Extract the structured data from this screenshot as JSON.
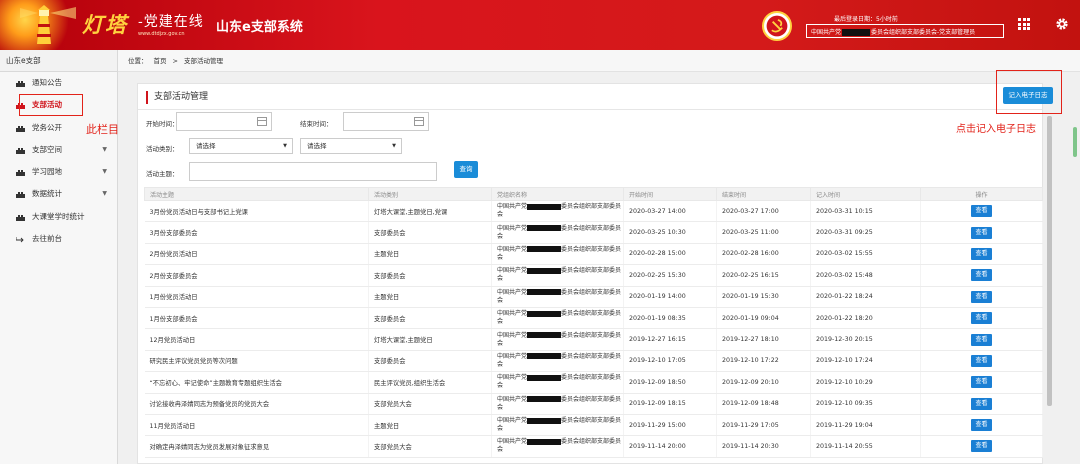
{
  "header": {
    "logo_main": "灯塔",
    "logo_sub": "-党建在线",
    "logo_url": "www.dtdjzx.gov.cn",
    "system_title": "山东e支部系统",
    "login_info": "最后登录日期：5小时前",
    "user_prefix": "中国共产党",
    "user_suffix": "委员会组织部支部委员会-党支部管理员"
  },
  "sidebar": {
    "title": "山东e支部",
    "items": [
      {
        "label": "通知公告",
        "caret": ""
      },
      {
        "label": "支部活动",
        "caret": ""
      },
      {
        "label": "党务公开",
        "caret": ""
      },
      {
        "label": "支部空间",
        "caret": "▼"
      },
      {
        "label": "学习园地",
        "caret": "▼"
      },
      {
        "label": "数据统计",
        "caret": "▼"
      },
      {
        "label": "大课堂学时统计",
        "caret": ""
      },
      {
        "label": "去往前台",
        "caret": ""
      }
    ]
  },
  "breadcrumb": {
    "prefix": "位置：",
    "home": "首页",
    "sep": ">",
    "current": "支部活动管理"
  },
  "panel": {
    "title": "支部活动管理"
  },
  "actions": {
    "log_button": "记入电子日志"
  },
  "annotations": {
    "left": "此栏目",
    "right": "点击记入电子日志"
  },
  "filters": {
    "start_label": "开始时间：",
    "end_label": "结束时间：",
    "category_label": "活动类别：",
    "category_select1": "请选择",
    "category_select2": "请选择",
    "topic_label": "活动主题：",
    "search_button": "查询"
  },
  "table": {
    "headers": [
      "活动主题",
      "活动类别",
      "党组织名称",
      "开始时间",
      "结束时间",
      "记入时间",
      "操作"
    ],
    "org_pre": "中国共产党",
    "org_post": "委员会组织部支部委员会",
    "view_label": "查看",
    "rows": [
      {
        "topic": "3月份党员活动日与支部书记上党课",
        "category": "灯塔大课堂,主题党日,党课",
        "start": "2020-03-27 14:00",
        "end": "2020-03-27 17:00",
        "recorded": "2020-03-31 10:15"
      },
      {
        "topic": "3月份支部委员会",
        "category": "支部委员会",
        "start": "2020-03-25 10:30",
        "end": "2020-03-25 11:00",
        "recorded": "2020-03-31 09:25"
      },
      {
        "topic": "2月份党员活动日",
        "category": "主题党日",
        "start": "2020-02-28 15:00",
        "end": "2020-02-28 16:00",
        "recorded": "2020-03-02 15:55"
      },
      {
        "topic": "2月份支部委员会",
        "category": "支部委员会",
        "start": "2020-02-25 15:30",
        "end": "2020-02-25 16:15",
        "recorded": "2020-03-02 15:48"
      },
      {
        "topic": "1月份党员活动日",
        "category": "主题党日",
        "start": "2020-01-19 14:00",
        "end": "2020-01-19 15:30",
        "recorded": "2020-01-22 18:24"
      },
      {
        "topic": "1月份支部委员会",
        "category": "支部委员会",
        "start": "2020-01-19 08:35",
        "end": "2020-01-19 09:04",
        "recorded": "2020-01-22 18:20"
      },
      {
        "topic": "12月党员活动日",
        "category": "灯塔大课堂,主题党日",
        "start": "2019-12-27 16:15",
        "end": "2019-12-27 18:10",
        "recorded": "2019-12-30 20:15"
      },
      {
        "topic": "研究民主评议党员党员等次问题",
        "category": "支部委员会",
        "start": "2019-12-10 17:05",
        "end": "2019-12-10 17:22",
        "recorded": "2019-12-10 17:24"
      },
      {
        "topic": "“不忘初心、牢记使命”主题教育专题组织生活会",
        "category": "民主评议党员,组织生活会",
        "start": "2019-12-09 18:50",
        "end": "2019-12-09 20:10",
        "recorded": "2019-12-10 10:29"
      },
      {
        "topic": "讨论接收冉泽婧同志为预备党员的党员大会",
        "category": "支部党员大会",
        "start": "2019-12-09 18:15",
        "end": "2019-12-09 18:48",
        "recorded": "2019-12-10 09:35"
      },
      {
        "topic": "11月党员活动日",
        "category": "主题党日",
        "start": "2019-11-29 15:00",
        "end": "2019-11-29 17:05",
        "recorded": "2019-11-29 19:04"
      },
      {
        "topic": "对确定冉泽婧同志为党员发展对象征求意见",
        "category": "支部党员大会",
        "start": "2019-11-14 20:00",
        "end": "2019-11-14 20:30",
        "recorded": "2019-11-14 20:55"
      }
    ]
  }
}
